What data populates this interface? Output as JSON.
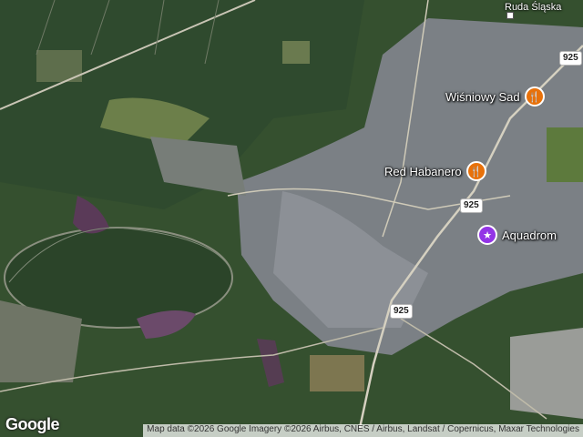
{
  "map": {
    "town": "Ruda Śląska",
    "road_shields": [
      "925",
      "925",
      "925"
    ],
    "places": [
      {
        "name": "Wiśniowy Sad",
        "icon": "restaurant-icon"
      },
      {
        "name": "Red Habanero",
        "icon": "restaurant-icon"
      },
      {
        "name": "Aquadrom",
        "icon": "attraction-icon"
      }
    ],
    "logo": "Google",
    "attribution": "Map data ©2026 Google Imagery ©2026 Airbus, CNES / Airbus, Landsat / Copernicus, Maxar Technologies",
    "colors": {
      "forest": "#2f4a2e",
      "urban": "#7d8286",
      "restaurant_pin": "#e8710a",
      "attraction_pin": "#9334e6"
    }
  }
}
